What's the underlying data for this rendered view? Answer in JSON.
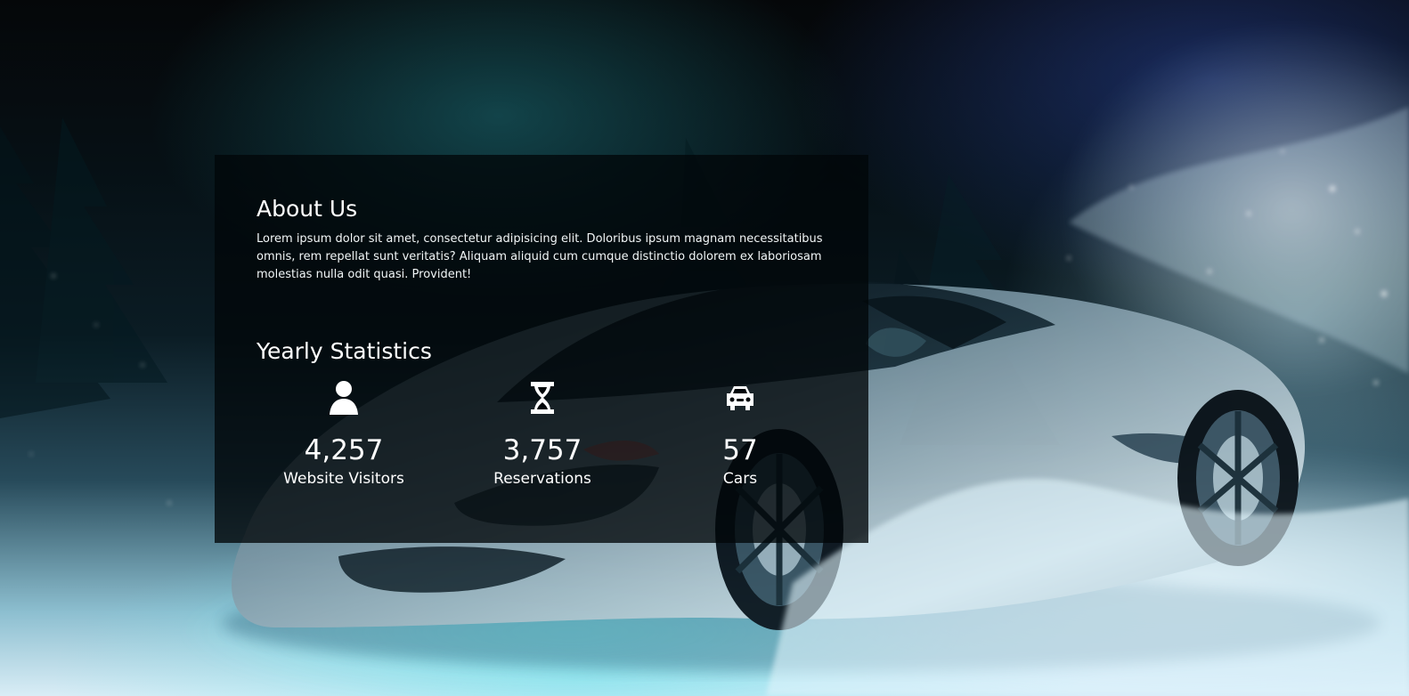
{
  "about": {
    "title": "About Us",
    "text": "Lorem ipsum dolor sit amet, consectetur adipisicing elit. Doloribus ipsum magnam necessitatibus omnis, rem repellat sunt veritatis? Aliquam aliquid cum cumque distinctio dolorem ex laboriosam molestias nulla odit quasi. Provident!"
  },
  "statistics": {
    "title": "Yearly Statistics",
    "items": [
      {
        "icon": "user-icon",
        "value": "4,257",
        "label": "Website Visitors"
      },
      {
        "icon": "hourglass-icon",
        "value": "3,757",
        "label": "Reservations"
      },
      {
        "icon": "car-icon",
        "value": "57",
        "label": "Cars"
      }
    ]
  },
  "colors": {
    "panel_background": "#010609",
    "text": "#ffffff",
    "glow_teal": "#76e2ec",
    "glow_blue": "#2a46a0"
  }
}
